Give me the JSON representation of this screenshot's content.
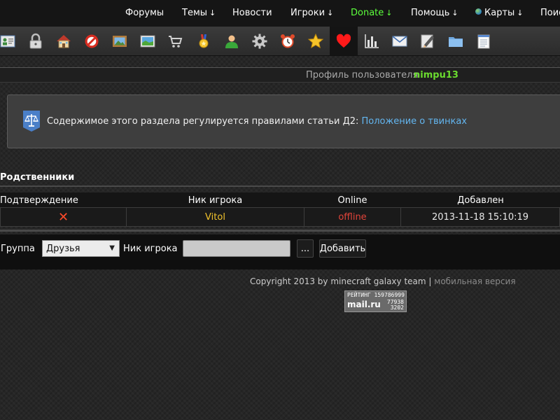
{
  "nav": {
    "items": [
      {
        "label": "Форумы",
        "arrow": ""
      },
      {
        "label": "Темы",
        "arrow": "↓"
      },
      {
        "label": "Новости",
        "arrow": ""
      },
      {
        "label": "Игроки",
        "arrow": "↓"
      },
      {
        "label": "Donate",
        "arrow": "↓"
      },
      {
        "label": "Помощь",
        "arrow": "↓"
      },
      {
        "label": "Карты",
        "arrow": "↓"
      },
      {
        "label": "Поиск",
        "arrow": ""
      }
    ]
  },
  "toolbar": {
    "icons": [
      "contact-card-icon",
      "lock-icon",
      "home-icon",
      "no-entry-icon",
      "picture-frame-icon",
      "landscape-image-icon",
      "shopping-cart-icon",
      "medal-icon",
      "user-icon",
      "gear-icon",
      "alarm-clock-icon",
      "star-icon",
      "heart-icon",
      "bar-chart-icon",
      "envelope-icon",
      "edit-icon",
      "folder-icon",
      "notepad-icon"
    ],
    "active": "heart-icon"
  },
  "profile": {
    "title": "Профиль пользователя",
    "username": "nimpu13"
  },
  "notice": {
    "text": "Содержимое этого раздела регулируется правилами статьи Д2:",
    "link": "Положение о твинках"
  },
  "relatives": {
    "title": "Родственники",
    "columns": [
      "Подтверждение",
      "Ник игрока",
      "Online",
      "Добавлен"
    ],
    "rows": [
      {
        "confirm": "✕",
        "nick": "Vitol",
        "online": "offline",
        "added": "2013-11-18 15:10:19"
      }
    ]
  },
  "form": {
    "group_label": "Группа",
    "group_value": "Друзья",
    "nick_label": "Ник игрока",
    "nick_value": "",
    "browse_label": "...",
    "add_label": "Добавить"
  },
  "footer": {
    "copyright": "Copyright 2013 by minecraft galaxy team",
    "separator": "|",
    "mobile": "мобильная версия"
  },
  "counter": {
    "label": "РЕЙТИНГ",
    "value1": "15978",
    "value1b": "6999",
    "brand": "mail.ru",
    "value2": "77938",
    "value3": "3202"
  },
  "colors": {
    "accent_green": "#5cff3c",
    "username_green": "#6bdc2f",
    "link_blue": "#63b6f0",
    "nick_gold": "#f2c32c",
    "offline_red": "#e2443a"
  }
}
